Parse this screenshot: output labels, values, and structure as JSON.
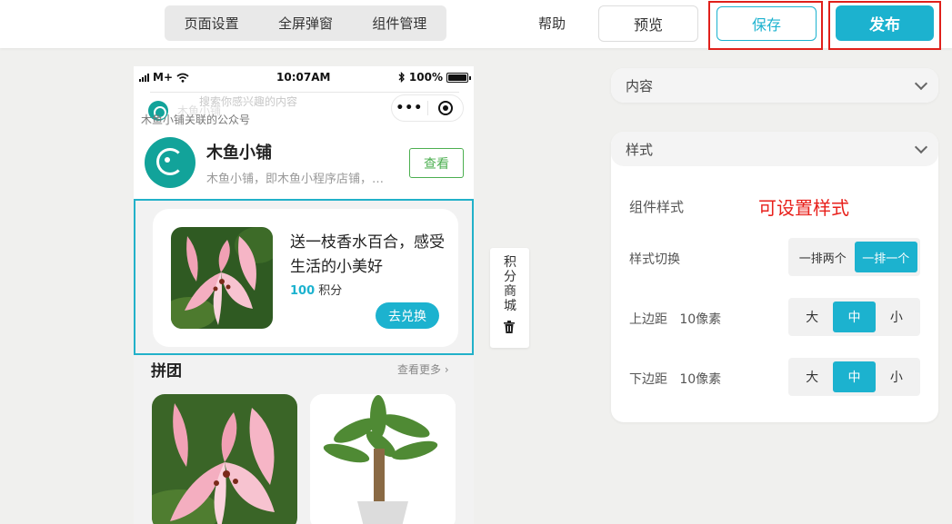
{
  "topbar": {
    "tabs": [
      "页面设置",
      "全屏弹窗",
      "组件管理"
    ],
    "help": "帮助",
    "preview": "预览",
    "save": "保存",
    "publish": "发布"
  },
  "phone": {
    "status": {
      "carrier": "M+",
      "time": "10:07AM",
      "battery": "100%"
    },
    "ghost_search": "搜索你感兴趣的内容",
    "ghost_name": "木鱼小铺",
    "related_label": "木鱼小铺关联的公众号",
    "shop": {
      "name": "木鱼小铺",
      "desc": "木鱼小铺，即木鱼小程序店铺，…",
      "view_btn": "查看"
    },
    "points": {
      "title": "送一枝香水百合，感受生活的小美好",
      "value": "100",
      "unit": " 积分",
      "btn": "去兑换"
    },
    "group": {
      "title": "拼团",
      "more": "查看更多"
    },
    "side_widget": {
      "label": "积分商城"
    }
  },
  "panels": {
    "content_title": "内容",
    "style_title": "样式",
    "component_style": "组件样式",
    "hint": "可设置样式",
    "style_switch": {
      "label": "样式切换",
      "options": [
        "一排两个",
        "一排一个"
      ],
      "active": 1
    },
    "top_margin": {
      "label": "上边距",
      "value": "10像素",
      "options": [
        "大",
        "中",
        "小"
      ],
      "active": 1
    },
    "bottom_margin": {
      "label": "下边距",
      "value": "10像素",
      "options": [
        "大",
        "中",
        "小"
      ],
      "active": 1
    }
  },
  "colors": {
    "accent": "#1cb2cf",
    "highlight": "#e0201b",
    "brand_green": "#12a39a"
  }
}
